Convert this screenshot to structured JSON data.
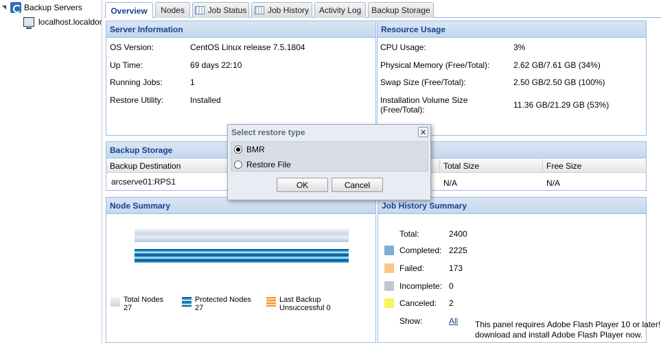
{
  "tree": {
    "root_label": "Backup Servers",
    "child_label": "localhost.localdoma"
  },
  "tabs": [
    {
      "label": "Overview",
      "active": true
    },
    {
      "label": "Nodes"
    },
    {
      "label": "Job Status"
    },
    {
      "label": "Job History"
    },
    {
      "label": "Activity Log"
    },
    {
      "label": "Backup Storage"
    }
  ],
  "server_info": {
    "title": "Server Information",
    "rows": [
      {
        "label": "OS Version:",
        "value": "CentOS Linux release 7.5.1804"
      },
      {
        "label": "Up Time:",
        "value": "69 days 22:10"
      },
      {
        "label": "Running Jobs:",
        "value": "1"
      },
      {
        "label": "Restore Utility:",
        "value": "Installed"
      }
    ]
  },
  "resource_usage": {
    "title": "Resource Usage",
    "rows": [
      {
        "label": "CPU Usage:",
        "value": "3%"
      },
      {
        "label": "Physical Memory (Free/Total):",
        "value": "2.62 GB/7.61 GB (34%)"
      },
      {
        "label": "Swap Size (Free/Total):",
        "value": "2.50 GB/2.50 GB (100%)"
      },
      {
        "label": "Installation Volume Size",
        "label2": "(Free/Total):",
        "value": "11.36 GB/21.29 GB (53%)"
      }
    ]
  },
  "backup_storage": {
    "title": "Backup Storage",
    "columns": [
      "Backup Destination",
      "Total Size",
      "Free Size"
    ],
    "row": {
      "destination": "arcserve01:RPS1",
      "total": "N/A",
      "free": "N/A"
    }
  },
  "node_summary": {
    "title": "Node Summary",
    "legend": [
      {
        "label": "Total Nodes",
        "value": "27",
        "color": "#c9d6e6"
      },
      {
        "label": "Protected Nodes",
        "value": "27",
        "color": "#1e7fb8"
      },
      {
        "label": "Last Backup",
        "label2": "Unsuccessful",
        "value": "0",
        "color": "#f5b867"
      }
    ]
  },
  "job_history": {
    "title": "Job History Summary",
    "total_label": "Total:",
    "total_value": "2400",
    "rows": [
      {
        "label": "Completed:",
        "value": "2225",
        "color": "#7eaed8"
      },
      {
        "label": "Failed:",
        "value": "173",
        "color": "#f7c78a"
      },
      {
        "label": "Incomplete:",
        "value": "0",
        "color": "#c3c7cc"
      },
      {
        "label": "Canceled:",
        "value": "2",
        "color": "#f6f55a"
      }
    ],
    "show_label": "Show:",
    "show_link": "All",
    "flash_line1": "This panel requires Adobe Flash Player 10 or later!",
    "flash_line2": "download and install Adobe Flash Player now."
  },
  "dialog": {
    "title": "Select restore type",
    "options": [
      {
        "label": "BMR",
        "checked": true
      },
      {
        "label": "Restore File",
        "checked": false
      }
    ],
    "ok_label": "OK",
    "cancel_label": "Cancel",
    "close_glyph": "✕"
  }
}
